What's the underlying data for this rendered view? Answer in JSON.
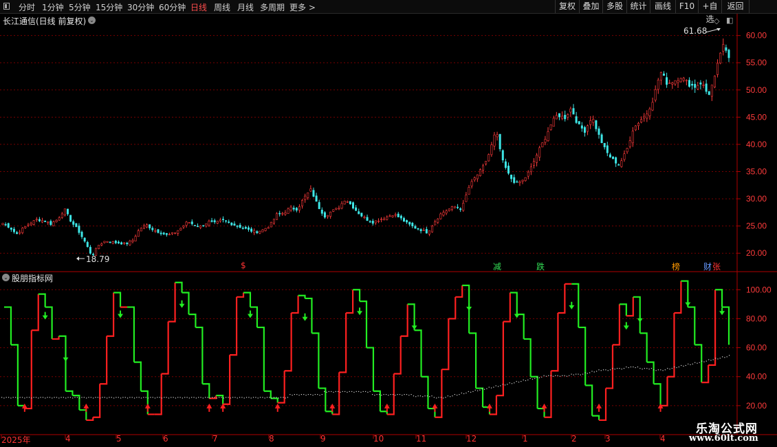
{
  "toolbar": {
    "periods": [
      "分时",
      "1分钟",
      "5分钟",
      "15分钟",
      "30分钟",
      "60分钟",
      "日线",
      "周线",
      "月线",
      "多周期",
      "更多 >"
    ],
    "active_period": "日线",
    "actions": [
      "复权",
      "叠加",
      "多股",
      "统计",
      "画线",
      "F10",
      "+自选",
      "返回"
    ]
  },
  "main_pane": {
    "title": "长江通信(日线 前复权)",
    "high_label": "61.68",
    "low_label": "18.79",
    "event_markers": [
      "$",
      "减",
      "跌",
      "榜",
      "财",
      "张"
    ]
  },
  "indicator_pane": {
    "title": "股朋指标网"
  },
  "x_axis": {
    "labels": [
      "2025年",
      "4",
      "5",
      "6",
      "7",
      "8",
      "9",
      "10",
      "11",
      "12",
      "1",
      "2",
      "3",
      "4"
    ]
  },
  "watermark": {
    "line1": "乐淘公式网",
    "line2": "www.60lt.com"
  },
  "chart_data": [
    {
      "type": "candlestick",
      "title": "长江通信(日线 前复权)",
      "y_ticks": [
        20,
        25,
        30,
        35,
        40,
        45,
        50,
        55,
        60
      ],
      "ylim": [
        17.5,
        64
      ],
      "high": 61.68,
      "low": 18.79,
      "close_path": [
        25.5,
        24.8,
        23.5,
        24.6,
        25.5,
        26.2,
        26.0,
        25.4,
        26.2,
        28.1,
        25.8,
        24.2,
        22.1,
        19.5,
        21.5,
        22.3,
        22.0,
        21.9,
        21.7,
        22.4,
        24.5,
        25.2,
        24.3,
        23.8,
        23.3,
        23.7,
        24.6,
        25.8,
        25.2,
        24.9,
        25.8,
        25.5,
        26.1,
        25.6,
        25.1,
        24.7,
        24.2,
        23.9,
        24.3,
        25.1,
        27.1,
        27.4,
        28.3,
        28.1,
        30.2,
        31.7,
        28.7,
        26.8,
        27.7,
        28.3,
        30.0,
        28.7,
        27.3,
        26.3,
        25.7,
        26.2,
        26.6,
        27.2,
        26.5,
        25.5,
        24.8,
        24.3,
        23.8,
        25.7,
        27.3,
        28.0,
        28.6,
        28.1,
        32.0,
        34.0,
        35.5,
        38.3,
        42.5,
        36.8,
        34.0,
        32.8,
        33.4,
        35.3,
        38.2,
        40.7,
        43.6,
        45.5,
        44.8,
        46.7,
        43.5,
        42.5,
        45.2,
        41.7,
        38.8,
        37.2,
        36.3,
        38.6,
        42.8,
        44.4,
        45.6,
        48.5,
        53.4,
        51.2,
        51.7,
        52.5,
        51.2,
        50.6,
        51.4,
        49.0,
        52.4,
        58.3,
        56.0
      ]
    },
    {
      "type": "line",
      "title": "股朋指标网",
      "y_ticks": [
        20,
        40,
        60,
        80,
        100
      ],
      "ylim": [
        0,
        112
      ],
      "series": [
        {
          "values": [
            88,
            62,
            20,
            18,
            72,
            97,
            88,
            66,
            68,
            30,
            27,
            17,
            10,
            12,
            35,
            68,
            98,
            88,
            88,
            50,
            30,
            14,
            14,
            42,
            78,
            105,
            98,
            83,
            74,
            35,
            25,
            27,
            21,
            55,
            95,
            98,
            88,
            74,
            30,
            25,
            22,
            44,
            84,
            96,
            94,
            70,
            32,
            16,
            14,
            43,
            84,
            100,
            92,
            60,
            30,
            16,
            14,
            42,
            68,
            90,
            72,
            40,
            18,
            12,
            45,
            80,
            95,
            103,
            70,
            32,
            19,
            14,
            27,
            78,
            98,
            83,
            66,
            40,
            18,
            12,
            44,
            84,
            104,
            104,
            74,
            34,
            13,
            10,
            32,
            62,
            90,
            82,
            95,
            70,
            50,
            35,
            20,
            40,
            84,
            106,
            88,
            62,
            36,
            48,
            100,
            88,
            62
          ]
        },
        {
          "values": [
            26,
            26,
            26,
            26,
            26,
            26,
            26,
            26,
            26,
            26,
            26,
            26,
            26,
            26,
            26,
            26,
            26,
            26,
            26,
            26,
            26,
            26,
            26,
            26,
            26,
            26,
            26,
            26,
            26,
            26,
            26,
            26,
            26,
            26,
            26,
            26,
            26,
            26,
            26,
            26,
            26,
            26,
            28,
            28,
            28,
            28,
            28,
            30,
            30,
            30,
            30,
            30,
            30,
            30,
            28,
            28,
            28,
            28,
            28,
            28,
            27,
            27,
            27,
            26,
            26,
            27,
            28,
            29,
            30,
            31,
            32,
            33,
            34,
            35,
            36,
            37,
            38,
            39,
            40,
            41,
            41,
            41,
            41,
            42,
            42,
            43,
            44,
            45,
            45,
            46,
            46,
            47,
            47,
            46,
            46,
            45,
            45,
            46,
            47,
            48,
            49,
            50,
            51,
            52,
            53,
            54,
            55
          ]
        }
      ]
    }
  ]
}
